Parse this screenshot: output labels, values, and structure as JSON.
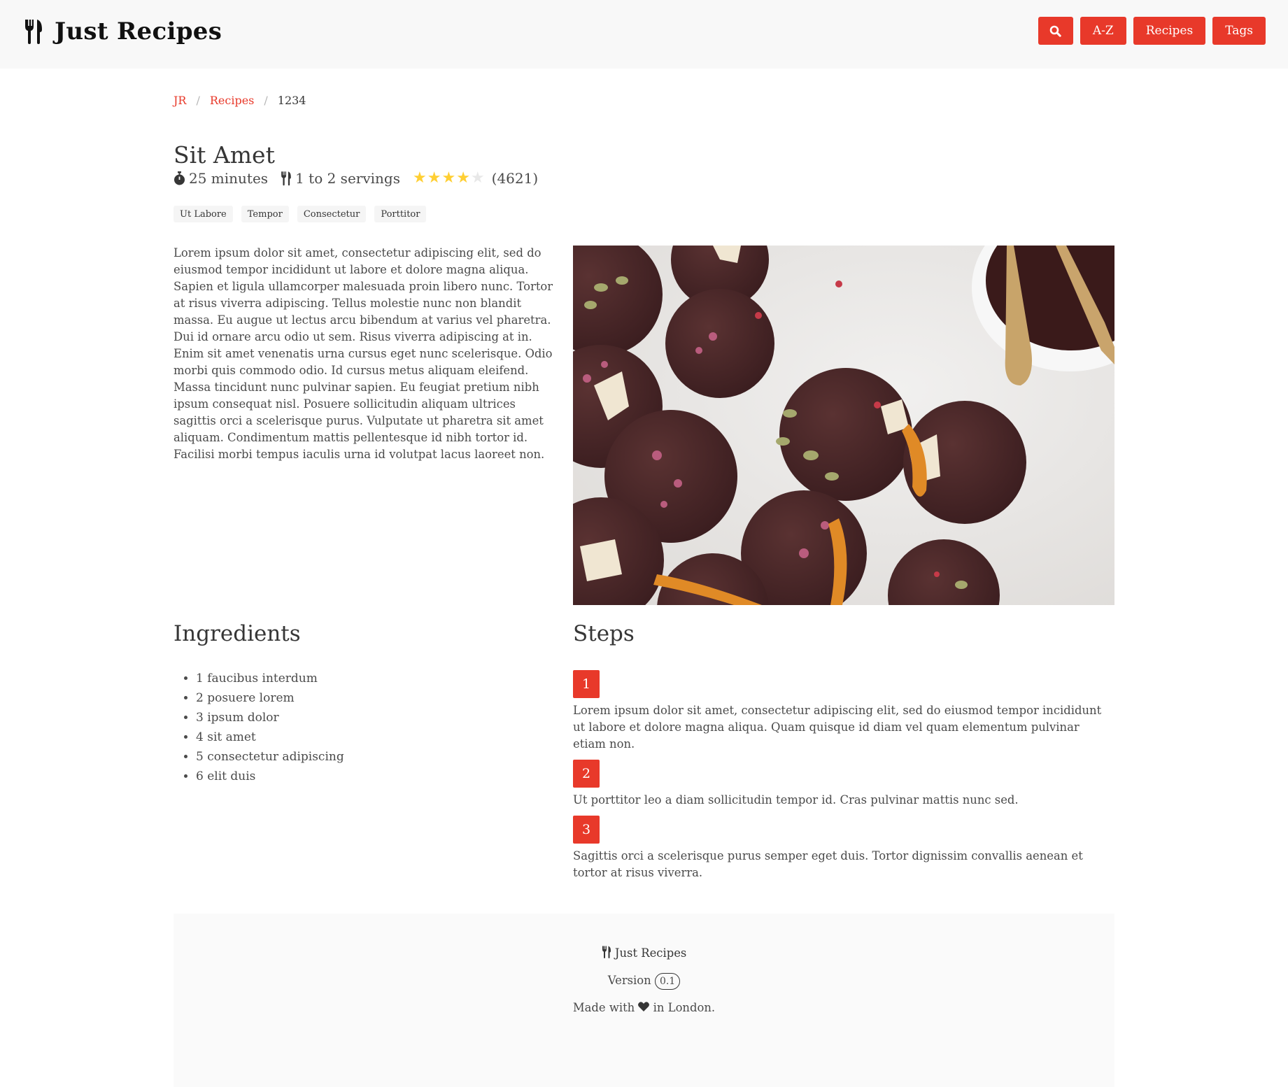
{
  "app": {
    "brand": "Just Recipes",
    "brand_icon": "utensils-icon",
    "accent_color": "#e8392a"
  },
  "nav": {
    "search_icon": "search-icon",
    "buttons": [
      "A-Z",
      "Recipes",
      "Tags"
    ]
  },
  "breadcrumb": {
    "items": [
      "JR",
      "Recipes"
    ],
    "current": "1234"
  },
  "recipe": {
    "title": "Sit Amet",
    "time": "25 minutes",
    "servings": "1 to 2 servings",
    "rating": 4,
    "rating_max": 5,
    "rating_count": "(4621)",
    "tags": [
      "Ut Labore",
      "Tempor",
      "Consectetur",
      "Porttitor"
    ],
    "description": "Lorem ipsum dolor sit amet, consectetur adipiscing elit, sed do eiusmod tempor incididunt ut labore et dolore magna aliqua. Sapien et ligula ullamcorper malesuada proin libero nunc. Tortor at risus viverra adipiscing. Tellus molestie nunc non blandit massa. Eu augue ut lectus arcu bibendum at varius vel pharetra. Dui id ornare arcu odio ut sem. Risus viverra adipiscing at in. Enim sit amet venenatis urna cursus eget nunc scelerisque. Odio morbi quis commodo odio. Id cursus metus aliquam eleifend. Massa tincidunt nunc pulvinar sapien. Eu feugiat pretium nibh ipsum consequat nisl. Posuere sollicitudin aliquam ultrices sagittis orci a scelerisque purus. Vulputate ut pharetra sit amet aliquam. Condimentum mattis pellentesque id nibh tortor id. Facilisi morbi tempus iaculis urna id volutpat lacus laoreet non."
  },
  "ingredients": {
    "title": "Ingredients",
    "items": [
      "1 faucibus interdum",
      "2 posuere lorem",
      "3 ipsum dolor",
      "4 sit amet",
      "5 consectetur adipiscing",
      "6 elit duis"
    ]
  },
  "steps": {
    "title": "Steps",
    "items": [
      {
        "number": "1",
        "text": "Lorem ipsum dolor sit amet, consectetur adipiscing elit, sed do eiusmod tempor incididunt ut labore et dolore magna aliqua. Quam quisque id diam vel quam elementum pulvinar etiam non."
      },
      {
        "number": "2",
        "text": "Ut porttitor leo a diam sollicitudin tempor id. Cras pulvinar mattis nunc sed."
      },
      {
        "number": "3",
        "text": "Sagittis orci a scelerisque purus semper eget duis. Tortor dignissim convallis aenean et tortor at risus viverra."
      }
    ]
  },
  "footer": {
    "brand": "Just Recipes",
    "version_label": "Version",
    "version": "0.1",
    "made_prefix": "Made with",
    "made_suffix": "in London.",
    "heart_icon": "heart-icon"
  }
}
